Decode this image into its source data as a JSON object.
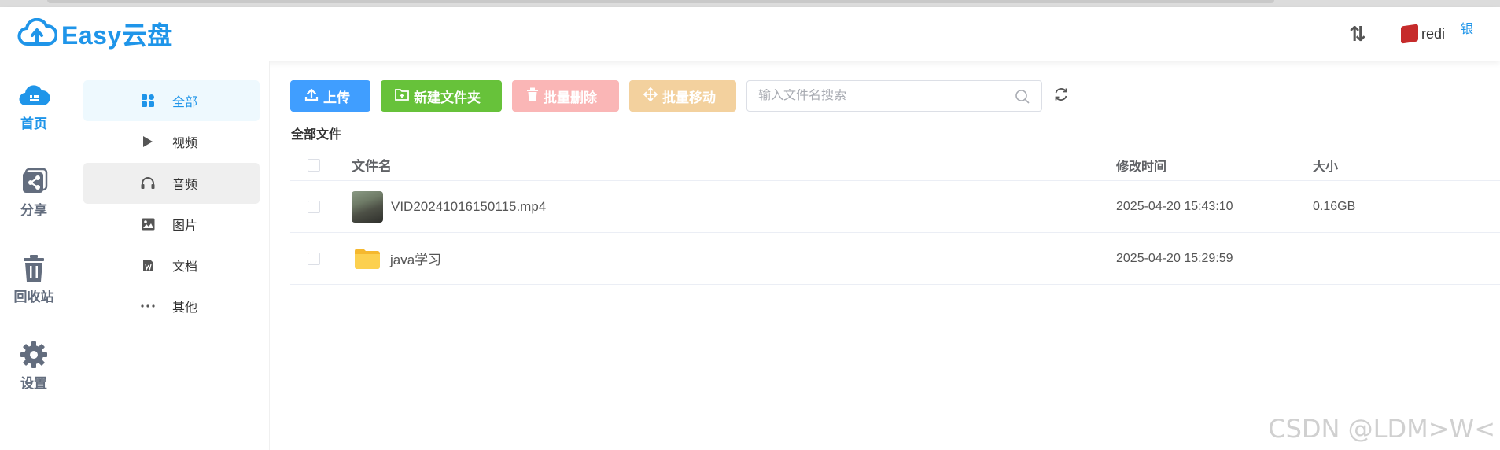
{
  "app": {
    "logo_text": "Easy云盘",
    "accent": "#1f95e9"
  },
  "header": {
    "sort_icon": "sort-arrows-icon",
    "user_name": "redi",
    "user_extra": "银"
  },
  "nav": {
    "items": [
      {
        "label": "首页",
        "icon": "cloud-home-icon",
        "active": true
      },
      {
        "label": "分享",
        "icon": "share-icon",
        "active": false
      },
      {
        "label": "回收站",
        "icon": "trash-icon",
        "active": false
      },
      {
        "label": "设置",
        "icon": "gear-icon",
        "active": false
      }
    ]
  },
  "subnav": {
    "items": [
      {
        "label": "全部",
        "icon": "grid-icon",
        "state": "active"
      },
      {
        "label": "视频",
        "icon": "play-icon",
        "state": ""
      },
      {
        "label": "音频",
        "icon": "headphones-icon",
        "state": "hover"
      },
      {
        "label": "图片",
        "icon": "image-icon",
        "state": ""
      },
      {
        "label": "文档",
        "icon": "document-icon",
        "state": ""
      },
      {
        "label": "其他",
        "icon": "more-icon",
        "state": ""
      }
    ]
  },
  "toolbar": {
    "upload_label": "上传",
    "new_folder_label": "新建文件夹",
    "batch_delete_label": "批量删除",
    "batch_move_label": "批量移动",
    "search_placeholder": "输入文件名搜索",
    "colors": {
      "upload": "#409eff",
      "new_folder": "#67c23a",
      "delete": "#fab6b6",
      "move": "#f3d19e"
    }
  },
  "breadcrumb": "全部文件",
  "table": {
    "headers": {
      "name": "文件名",
      "time": "修改时间",
      "size": "大小"
    },
    "rows": [
      {
        "name": "VID20241016150115.mp4",
        "time": "2025-04-20 15:43:10",
        "size": "0.16GB",
        "type": "video"
      },
      {
        "name": "java学习",
        "time": "2025-04-20 15:29:59",
        "size": "",
        "type": "folder"
      }
    ]
  },
  "watermark": "CSDN @LDM>W<"
}
